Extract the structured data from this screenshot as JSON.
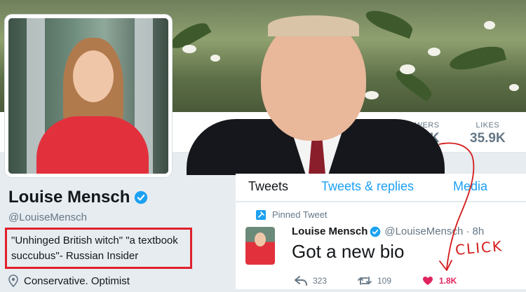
{
  "profile": {
    "name": "Louise Mensch",
    "handle": "@LouiseMensch",
    "bio": "\"Unhinged British witch\" \"a textbook succubus\"- Russian Insider",
    "location": "Conservative. Optimist"
  },
  "stats": {
    "followers_label": "FOLLOWERS",
    "followers_value": "K",
    "likes_label": "LIKES",
    "likes_value": "35.9K"
  },
  "tabs": {
    "tweets": "Tweets",
    "replies": "Tweets & replies",
    "media": "Media"
  },
  "tweet": {
    "pinned_label": "Pinned Tweet",
    "author_name": "Louise Mensch",
    "author_handle": "@LouiseMensch",
    "time": "· 8h",
    "text": "Got a new bio",
    "replies": "323",
    "retweets": "109",
    "likes": "1.8K"
  },
  "annotation": {
    "click_text": "CLICK",
    "color": "#d41a1a"
  },
  "colors": {
    "accent": "#1da1f2",
    "like": "#e0245e",
    "highlight_box": "#e0202c"
  },
  "icons": [
    "verified-badge-icon",
    "location-pin-icon",
    "pin-icon",
    "reply-icon",
    "retweet-icon",
    "heart-icon"
  ]
}
